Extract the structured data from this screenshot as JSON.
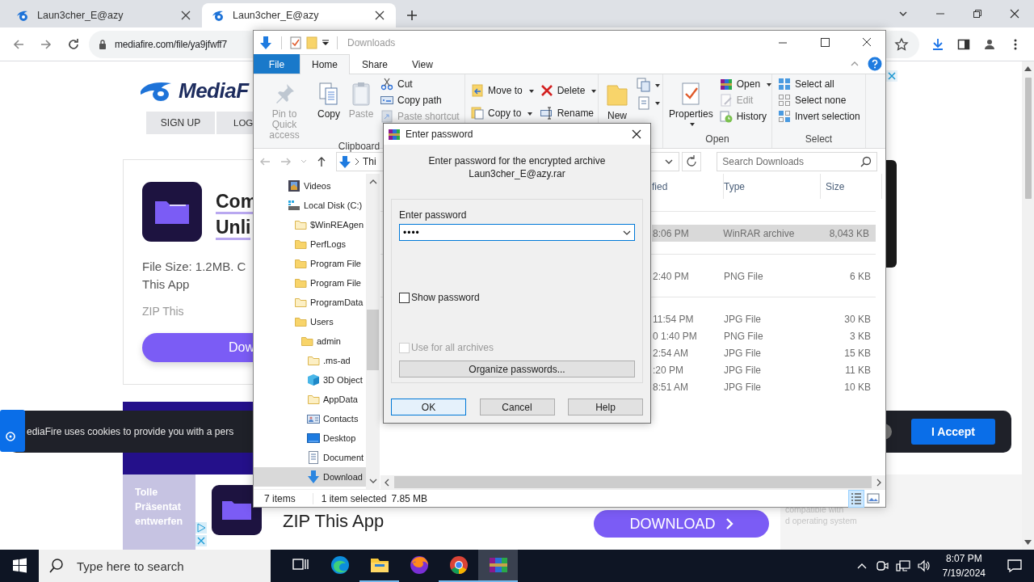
{
  "browser": {
    "tabs": [
      {
        "title": "Laun3cher_E@azy",
        "selected": false
      },
      {
        "title": "Laun3cher_E@azy",
        "selected": true
      }
    ],
    "url": "mediafire.com/file/ya9jfwff7"
  },
  "page": {
    "logo": "MediaF",
    "nav_buttons": [
      "SIGN UP",
      "LOG"
    ],
    "card": {
      "title_lines": [
        "Com",
        "Unli"
      ],
      "detail_lines": [
        "File Size: 1.2MB. C",
        "This App"
      ],
      "caption": "ZIP This",
      "button": "Dow"
    },
    "cookie_bar": {
      "text": "ediaFire uses cookies to provide you with a pers",
      "button": "I Accept"
    },
    "bottom_ad": {
      "banner_lines": [
        "Tolle",
        "Präsentat",
        "entwerfen"
      ],
      "title": "ZIP This App",
      "button": "DOWNLOAD",
      "note_lines": [
        "compatible with",
        "d operating system"
      ]
    }
  },
  "explorer": {
    "title": "Downloads",
    "ribbon_tabs": [
      {
        "label": "File",
        "kind": "menu",
        "selected": false
      },
      {
        "label": "Home",
        "kind": "tab",
        "selected": true
      },
      {
        "label": "Share",
        "kind": "tab",
        "selected": false
      },
      {
        "label": "View",
        "kind": "tab",
        "selected": false
      }
    ],
    "ribbon_groups": [
      {
        "label": "Clipboard",
        "columns": [
          [
            {
              "kind": "large",
              "label": "Pin to Quick access",
              "dropdown": false,
              "disabled": true
            }
          ],
          [
            {
              "kind": "large",
              "label": "Copy",
              "dropdown": false,
              "disabled": false
            }
          ],
          [
            {
              "kind": "large",
              "label": "Paste",
              "dropdown": false,
              "disabled": true
            }
          ],
          [
            {
              "kind": "small",
              "label": "Cut",
              "dropdown": false,
              "disabled": false
            },
            {
              "kind": "small",
              "label": "Copy path",
              "dropdown": false,
              "disabled": false
            },
            {
              "kind": "small",
              "label": "Paste shortcut",
              "dropdown": false,
              "disabled": true
            }
          ]
        ]
      },
      {
        "columns": [
          [
            {
              "kind": "small",
              "label": "Move to",
              "dropdown": true,
              "disabled": false
            },
            {
              "kind": "small",
              "label": "Copy to",
              "dropdown": true,
              "disabled": false
            }
          ],
          [
            {
              "kind": "small",
              "label": "Delete",
              "dropdown": true,
              "disabled": false
            },
            {
              "kind": "small",
              "label": "Rename",
              "dropdown": false,
              "disabled": false
            }
          ]
        ]
      },
      {
        "columns": [
          [
            {
              "kind": "large",
              "label": "New",
              "dropdown": false,
              "disabled": false
            }
          ],
          [
            {
              "kind": "icon",
              "dropdown": true,
              "disabled": false
            },
            {
              "kind": "icon",
              "dropdown": true,
              "disabled": false
            }
          ]
        ]
      },
      {
        "label": "Open",
        "columns": [
          [
            {
              "kind": "large",
              "label": "Properties",
              "dropdown": true,
              "disabled": false
            }
          ],
          [
            {
              "kind": "small",
              "label": "Open",
              "dropdown": true,
              "disabled": false
            },
            {
              "kind": "small",
              "label": "Edit",
              "dropdown": false,
              "disabled": true
            },
            {
              "kind": "small",
              "label": "History",
              "dropdown": false,
              "disabled": false
            }
          ]
        ]
      },
      {
        "label": "Select",
        "columns": [
          [
            {
              "kind": "small",
              "label": "Select all",
              "dropdown": false,
              "disabled": false
            },
            {
              "kind": "small",
              "label": "Select none",
              "dropdown": false,
              "disabled": false
            },
            {
              "kind": "small",
              "label": "Invert selection",
              "dropdown": false,
              "disabled": false
            }
          ]
        ]
      }
    ],
    "address": "Thi",
    "search": {
      "placeholder": "Search Downloads"
    },
    "tree": [
      {
        "label": "Videos",
        "kind": "videos",
        "selected": false
      },
      {
        "label": "Local Disk (C:)",
        "kind": "drive",
        "selected": false,
        "children": [
          {
            "label": "$WinREAgen",
            "kind": "folder",
            "hidden": true,
            "selected": false
          },
          {
            "label": "PerfLogs",
            "kind": "folder",
            "hidden": false,
            "selected": false
          },
          {
            "label": "Program File",
            "kind": "folder",
            "hidden": false,
            "selected": false
          },
          {
            "label": "Program File",
            "kind": "folder",
            "hidden": false,
            "selected": false
          },
          {
            "label": "ProgramData",
            "kind": "folder",
            "hidden": true,
            "selected": false
          },
          {
            "label": "Users",
            "kind": "folder",
            "hidden": false,
            "selected": false,
            "children": [
              {
                "label": "admin",
                "kind": "folder",
                "hidden": false,
                "selected": false,
                "children": [
                  {
                    "label": ".ms-ad",
                    "kind": "folder",
                    "hidden": true,
                    "selected": false
                  },
                  {
                    "label": "3D Object",
                    "kind": "cube",
                    "selected": false
                  },
                  {
                    "label": "AppData",
                    "kind": "folder",
                    "hidden": true,
                    "selected": false
                  },
                  {
                    "label": "Contacts",
                    "kind": "contacts",
                    "selected": false
                  },
                  {
                    "label": "Desktop",
                    "kind": "desktop",
                    "selected": false
                  },
                  {
                    "label": "Document",
                    "kind": "documents",
                    "selected": false
                  },
                  {
                    "label": "Download",
                    "kind": "downloads",
                    "selected": true
                  }
                ]
              }
            ]
          }
        ]
      }
    ],
    "columns": [
      "fied",
      "Type",
      "Size"
    ],
    "groups": [
      {
        "rows": [
          {
            "date": "8:06 PM",
            "type": "WinRAR archive",
            "size": "8,043 KB",
            "selected": true
          }
        ]
      },
      {
        "rows": [
          {
            "date": "2:40 PM",
            "type": "PNG File",
            "size": "6 KB",
            "selected": false
          }
        ]
      },
      {
        "rows": [
          {
            "date": "11:54 PM",
            "type": "JPG File",
            "size": "30 KB",
            "selected": false
          },
          {
            "date": "0 1:40 PM",
            "type": "PNG File",
            "size": "3 KB",
            "selected": false
          },
          {
            "date": "2:54 AM",
            "type": "JPG File",
            "size": "15 KB",
            "selected": false
          },
          {
            "date": ":20 PM",
            "type": "JPG File",
            "size": "11 KB",
            "selected": false
          },
          {
            "date": "8:51 AM",
            "type": "JPG File",
            "size": "10 KB",
            "selected": false
          }
        ]
      }
    ],
    "status": {
      "count": "7 items",
      "selection": "1 item selected",
      "size": "7.85 MB"
    },
    "views": [
      {
        "kind": "details",
        "selected": true
      },
      {
        "kind": "tiles",
        "selected": false
      }
    ]
  },
  "dialog": {
    "title": "Enter password",
    "message_lines": [
      "Enter password for the encrypted archive",
      "Laun3cher_E@azy.rar"
    ],
    "field_label": "Enter password",
    "password": "••••",
    "options": [
      {
        "label": "Show password",
        "checked": false,
        "disabled": false
      },
      {
        "label": "Use for all archives",
        "checked": false,
        "disabled": true
      }
    ],
    "organize_button": "Organize passwords...",
    "buttons": [
      {
        "label": "OK",
        "default": true
      },
      {
        "label": "Cancel",
        "default": false
      },
      {
        "label": "Help",
        "default": false
      }
    ]
  },
  "taskbar": {
    "search_placeholder": "Type here to search",
    "apps": [
      {
        "kind": "taskview",
        "running": false,
        "selected": false
      },
      {
        "kind": "edge",
        "running": false,
        "selected": false
      },
      {
        "kind": "files",
        "running": true,
        "selected": false
      },
      {
        "kind": "fox",
        "running": false,
        "selected": false
      },
      {
        "kind": "chrome",
        "running": true,
        "selected": false
      },
      {
        "kind": "archive",
        "running": true,
        "selected": true
      }
    ],
    "time": "8:07 PM",
    "date": "7/19/2024"
  }
}
